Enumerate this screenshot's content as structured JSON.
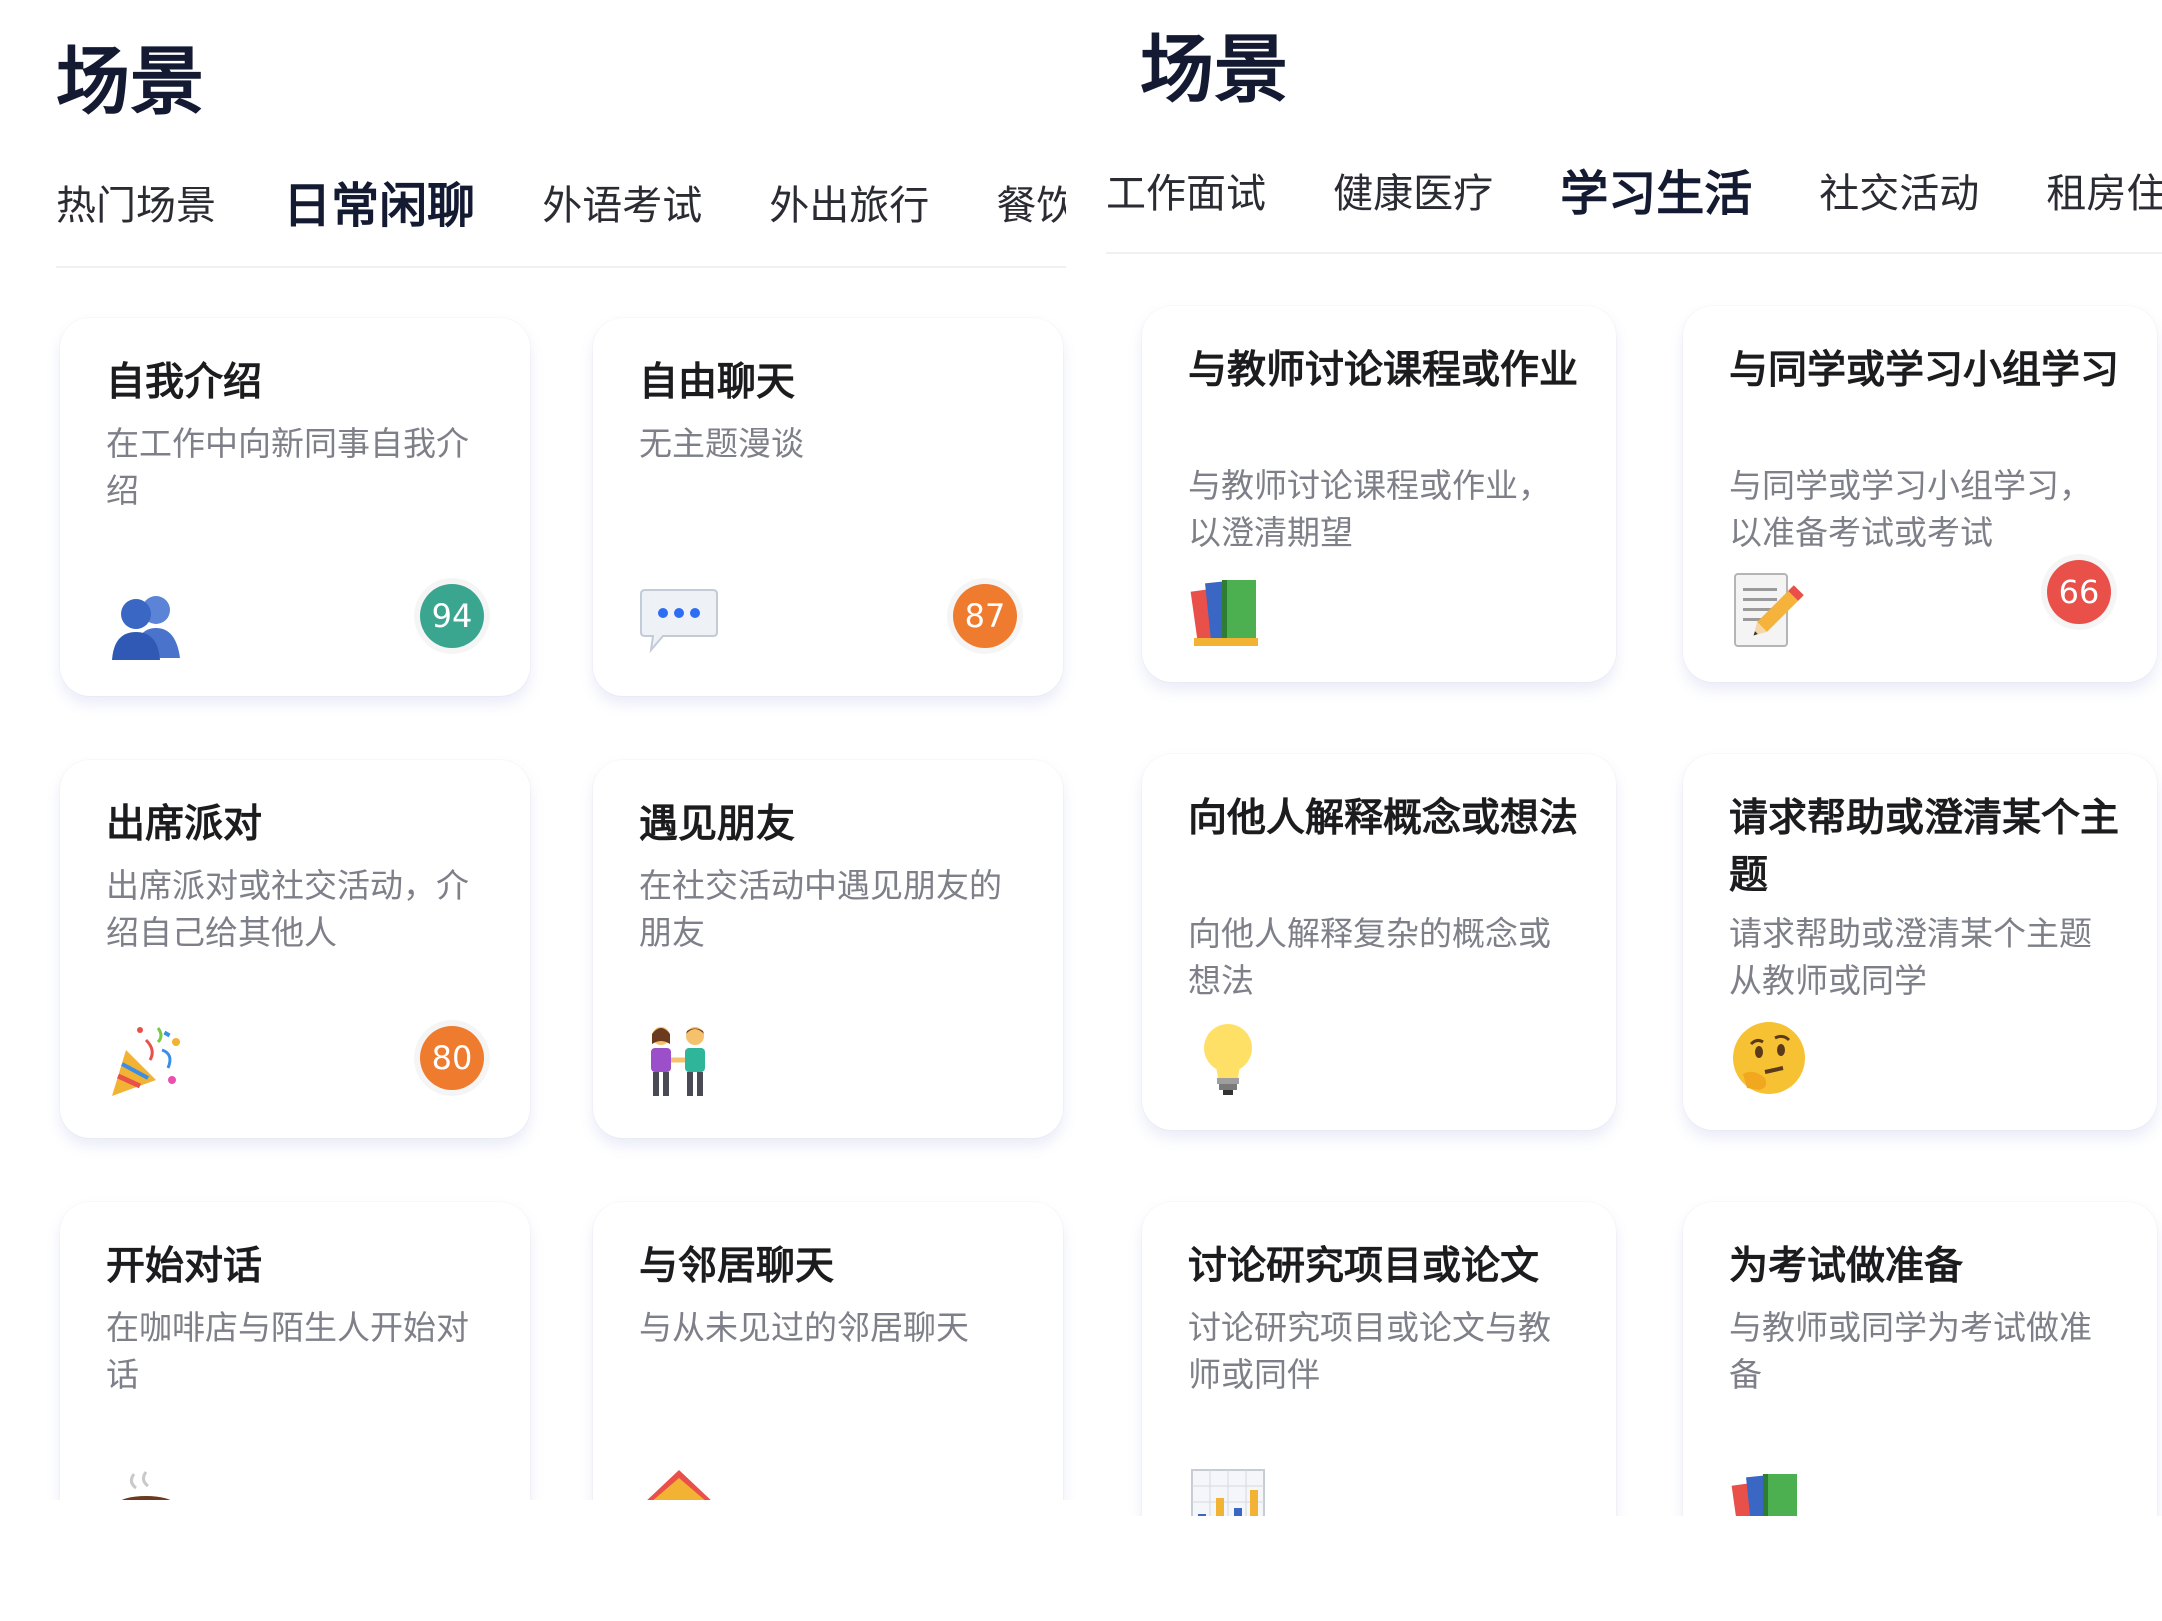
{
  "left": {
    "title": "场景",
    "tabs": [
      {
        "label": "热门场景",
        "active": false
      },
      {
        "label": "日常闲聊",
        "active": true
      },
      {
        "label": "外语考试",
        "active": false
      },
      {
        "label": "外出旅行",
        "active": false
      },
      {
        "label": "餐饮美",
        "active": false
      }
    ],
    "cards": [
      {
        "title": "自我介绍",
        "desc": "在工作中向新同事自我介绍",
        "icon": "two-people-icon",
        "emoji": "👥",
        "score": "94",
        "score_color": "#3aa68f"
      },
      {
        "title": "自由聊天",
        "desc": "无主题漫谈",
        "icon": "speech-bubble-icon",
        "emoji": "💬",
        "score": "87",
        "score_color": "#ef7b2f"
      },
      {
        "title": "出席派对",
        "desc": "出席派对或社交活动，介绍自己给其他人",
        "icon": "party-popper-icon",
        "emoji": "🎉",
        "score": "80",
        "score_color": "#ef7b2f"
      },
      {
        "title": "遇见朋友",
        "desc": "在社交活动中遇见朋友的朋友",
        "icon": "friends-holding-hands-icon",
        "emoji": "👫",
        "score": "",
        "score_color": ""
      },
      {
        "title": "开始对话",
        "desc": "在咖啡店与陌生人开始对话",
        "icon": "coffee-icon",
        "emoji": "☕",
        "score": "",
        "score_color": ""
      },
      {
        "title": "与邻居聊天",
        "desc": "与从未见过的邻居聊天",
        "icon": "house-icon",
        "emoji": "🏠",
        "score": "",
        "score_color": ""
      }
    ]
  },
  "right": {
    "title": "场景",
    "tabs": [
      {
        "label": "工作面试",
        "active": false
      },
      {
        "label": "健康医疗",
        "active": false
      },
      {
        "label": "学习生活",
        "active": true
      },
      {
        "label": "社交活动",
        "active": false
      },
      {
        "label": "租房住宿",
        "active": false
      }
    ],
    "cards": [
      {
        "title": "与教师讨论课程或作业",
        "desc": "与教师讨论课程或作业，以澄清期望",
        "icon": "books-icon",
        "emoji": "📚",
        "score": "",
        "score_color": ""
      },
      {
        "title": "与同学或学习小组学习",
        "desc": "与同学或学习小组学习，以准备考试或考试",
        "icon": "memo-pencil-icon",
        "emoji": "📝",
        "score": "66",
        "score_color": "#e9504a"
      },
      {
        "title": "向他人解释概念或想法",
        "desc": "向他人解释复杂的概念或想法",
        "icon": "light-bulb-icon",
        "emoji": "💡",
        "score": "",
        "score_color": ""
      },
      {
        "title": "请求帮助或澄清某个主题",
        "desc": "请求帮助或澄清某个主题从教师或同学",
        "icon": "thinking-face-icon",
        "emoji": "🤔",
        "score": "",
        "score_color": ""
      },
      {
        "title": "讨论研究项目或论文",
        "desc": "讨论研究项目或论文与教师或同伴",
        "icon": "bar-chart-icon",
        "emoji": "📊",
        "score": "",
        "score_color": ""
      },
      {
        "title": "为考试做准备",
        "desc": "与教师或同学为考试做准备",
        "icon": "books-icon",
        "emoji": "📚",
        "score": "",
        "score_color": ""
      }
    ]
  }
}
